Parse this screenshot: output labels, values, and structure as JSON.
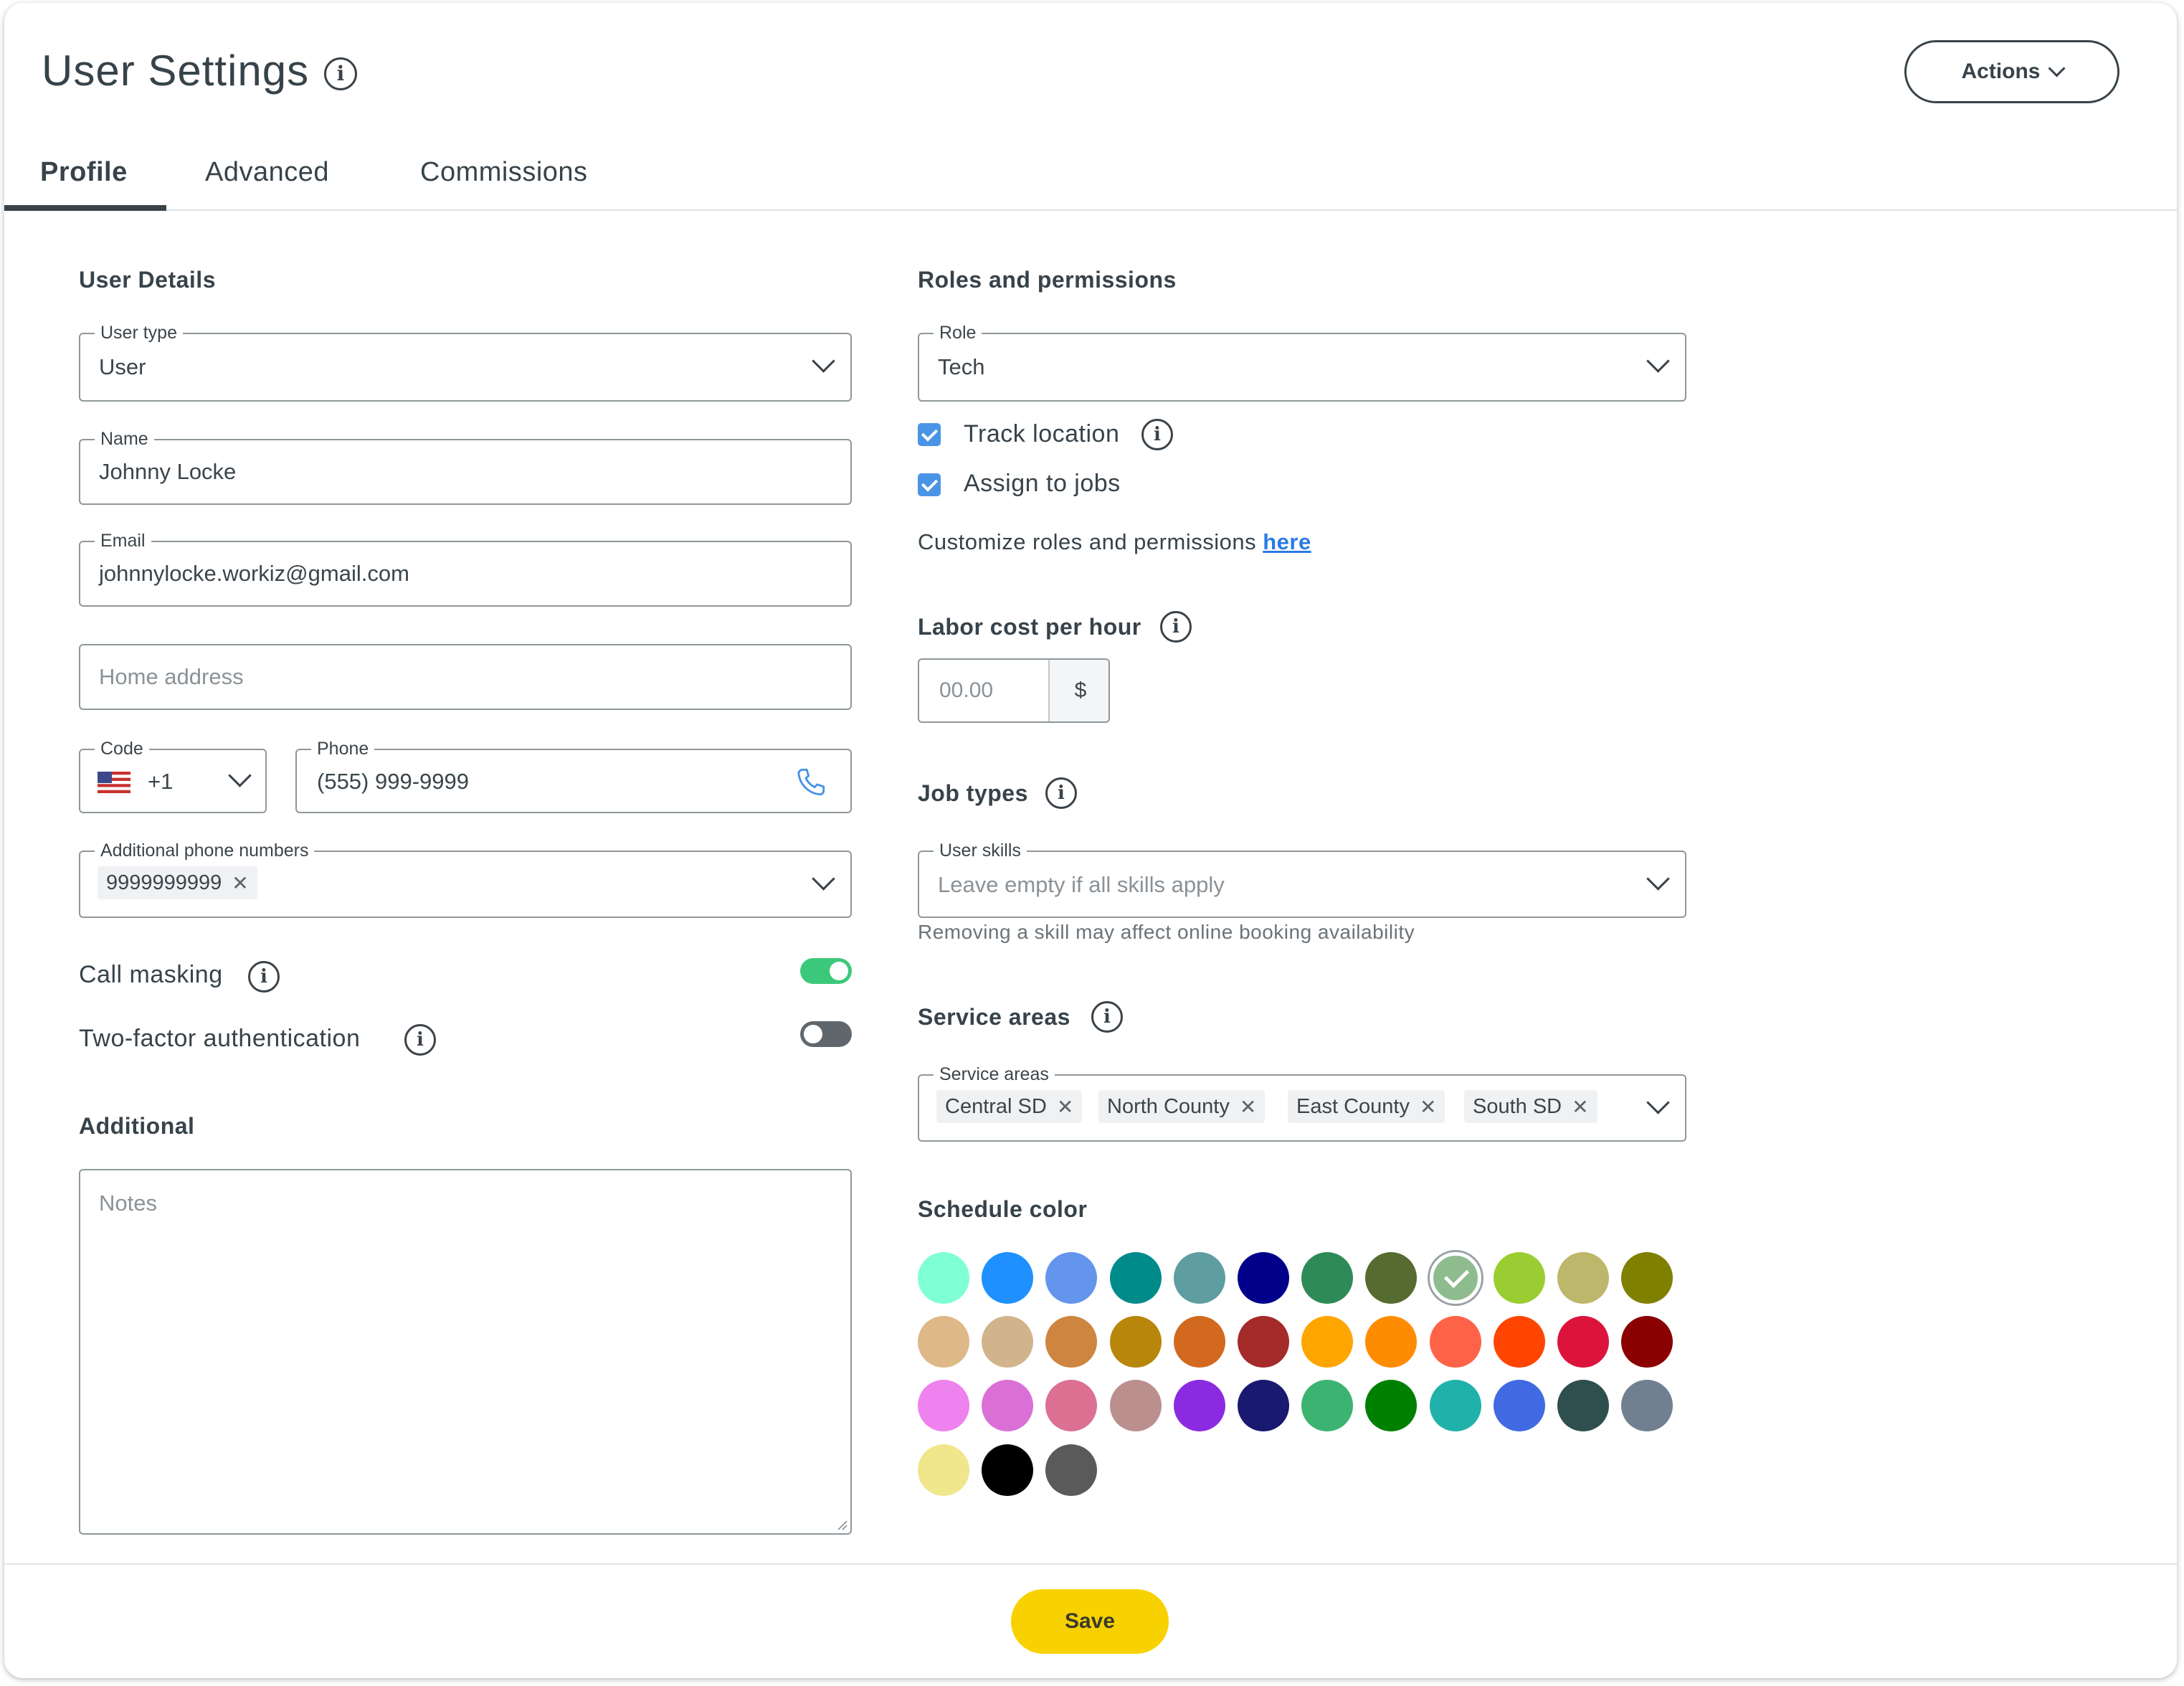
{
  "header": {
    "title": "User Settings",
    "actions_label": "Actions"
  },
  "tabs": [
    {
      "label": "Profile",
      "active": true
    },
    {
      "label": "Advanced",
      "active": false
    },
    {
      "label": "Commissions",
      "active": false
    }
  ],
  "user_details": {
    "section_title": "User Details",
    "user_type": {
      "label": "User type",
      "value": "User"
    },
    "name": {
      "label": "Name",
      "value": "Johnny Locke"
    },
    "email": {
      "label": "Email",
      "value": "johnnylocke.workiz@gmail.com"
    },
    "home_address": {
      "placeholder": "Home address"
    },
    "code": {
      "label": "Code",
      "value": "+1",
      "flag": "us-flag-icon"
    },
    "phone": {
      "label": "Phone",
      "value": "(555) 999-9999"
    },
    "additional_phones": {
      "label": "Additional phone numbers",
      "chips": [
        "9999999999"
      ]
    },
    "call_masking": {
      "label": "Call masking",
      "enabled": true
    },
    "two_factor": {
      "label": "Two-factor authentication",
      "enabled": false
    }
  },
  "additional": {
    "section_title": "Additional",
    "notes_placeholder": "Notes"
  },
  "roles": {
    "section_title": "Roles and permissions",
    "role": {
      "label": "Role",
      "value": "Tech"
    },
    "track_location": {
      "label": "Track location",
      "checked": true
    },
    "assign_to_jobs": {
      "label": "Assign to jobs",
      "checked": true
    },
    "customize_text": "Customize roles and permissions",
    "customize_link": "here"
  },
  "labor_cost": {
    "section_title": "Labor cost per hour",
    "placeholder": "00.00",
    "currency": "$"
  },
  "job_types": {
    "section_title": "Job types",
    "user_skills": {
      "label": "User skills",
      "placeholder": "Leave empty if all skills apply"
    },
    "helper": "Removing a skill may affect online booking availability"
  },
  "service_areas": {
    "section_title": "Service areas",
    "field_label": "Service areas",
    "chips": [
      "Central SD",
      "North County",
      "East County",
      "South SD"
    ]
  },
  "schedule_color": {
    "section_title": "Schedule color",
    "selected_index": 8,
    "colors": [
      "#7fffd4",
      "#1e90ff",
      "#6495ed",
      "#008b8b",
      "#5f9ea0",
      "#00008b",
      "#2e8b57",
      "#556b2f",
      "#8fbc8f",
      "#9acd32",
      "#bdb76b",
      "#808000",
      "#deb887",
      "#d2b48c",
      "#cd853f",
      "#b8860b",
      "#d2691e",
      "#a52a2a",
      "#ffa500",
      "#ff8c00",
      "#ff6347",
      "#ff4500",
      "#dc143c",
      "#8b0000",
      "#ee82ee",
      "#da70d6",
      "#db7093",
      "#bc8f8f",
      "#8a2be2",
      "#191970",
      "#3cb371",
      "#008000",
      "#20b2aa",
      "#4169e1",
      "#2f4f4f",
      "#708090",
      "#f0e68c",
      "#000000",
      "#5a5a5a"
    ]
  },
  "footer": {
    "save_label": "Save"
  },
  "theme": {
    "accent_link": "#2a7be4",
    "checkbox": "#4a94e6",
    "toggle_on": "#3cc87a",
    "toggle_off": "#5f676c",
    "save_button": "#f8d200"
  }
}
